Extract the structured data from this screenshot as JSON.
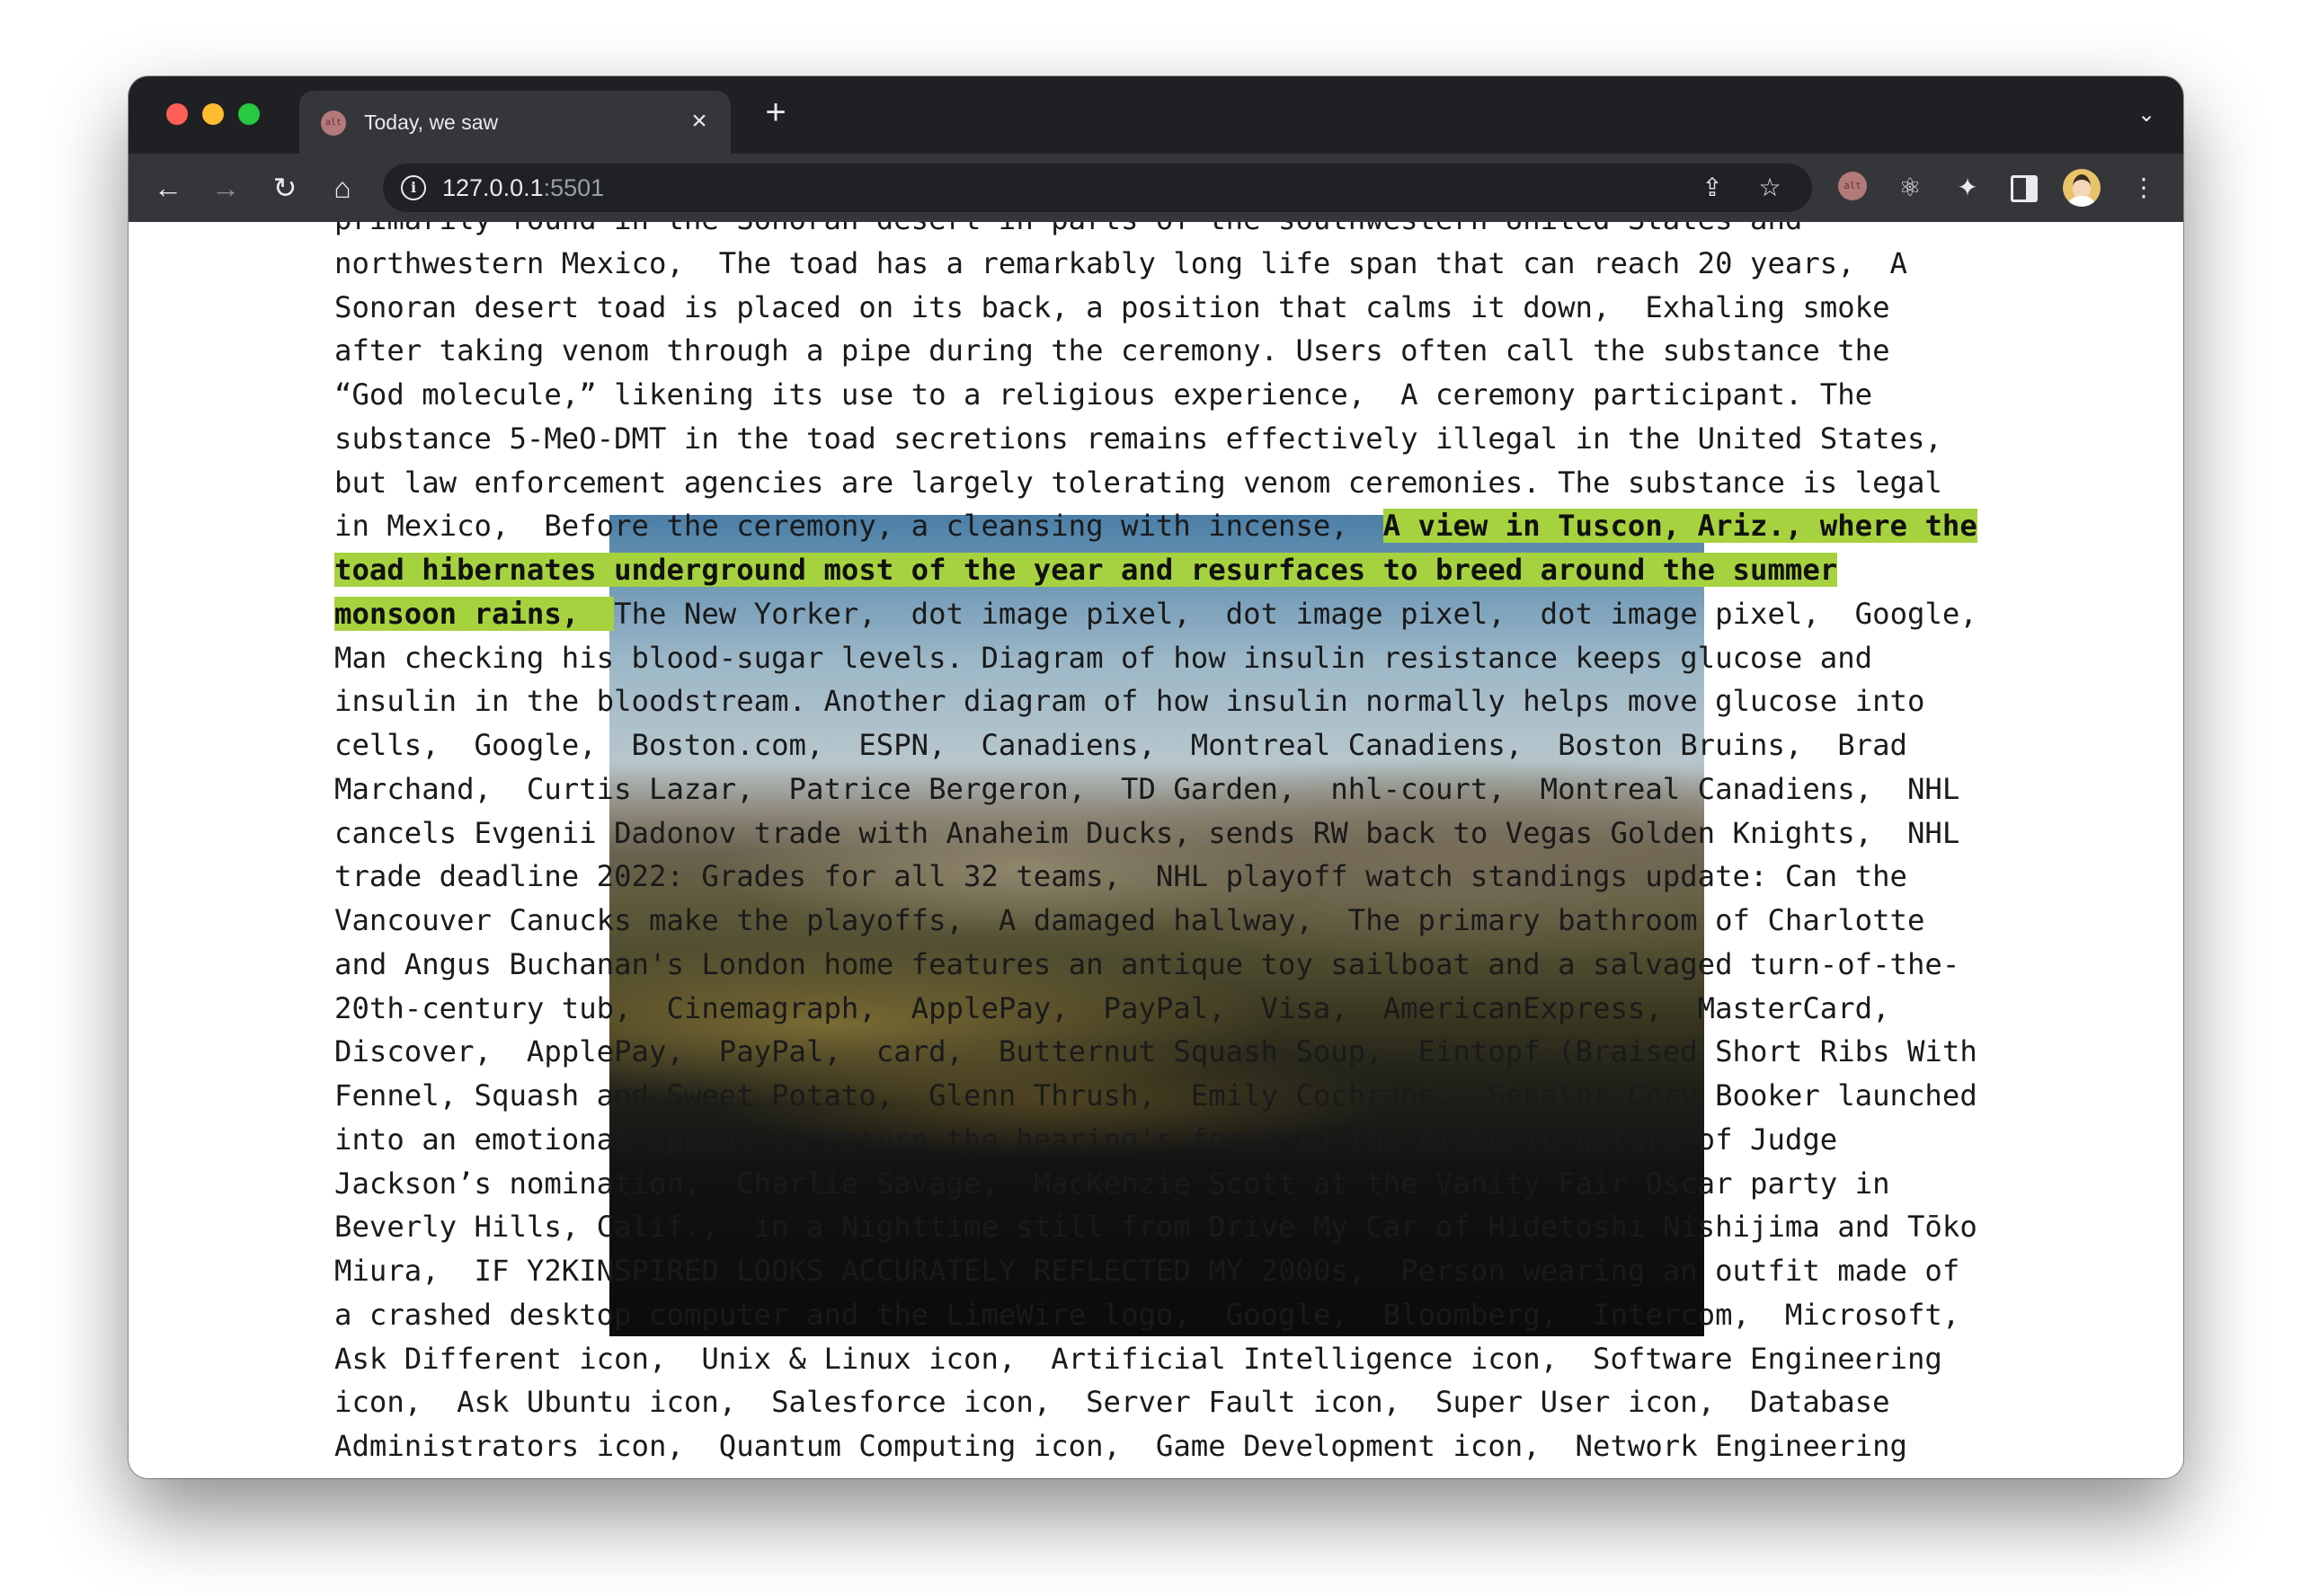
{
  "browser": {
    "tab": {
      "title": "Today, we saw",
      "favicon_text": "alt",
      "close_icon": "×"
    },
    "new_tab_icon": "+",
    "tab_search_icon": "⌄",
    "toolbar": {
      "back_icon": "←",
      "forward_icon": "→",
      "reload_icon": "↻",
      "home_icon": "⌂",
      "url_host": "127.0.0.1",
      "url_port": ":5501",
      "site_info_icon": "i",
      "share_icon": "⇪",
      "bookmark_icon": "☆",
      "extension_alt_text": "alt",
      "react_icon": "⚛",
      "extensions_icon": "✦",
      "menu_icon": "⋮"
    }
  },
  "page": {
    "lines": [
      {
        "before": "primarily found in the Sonoran desert in parts of the southwestern United States and",
        "hl": "",
        "after": ""
      },
      {
        "before": "northwestern Mexico,  The toad has a remarkably long life span that can reach 20 years,  A",
        "hl": "",
        "after": ""
      },
      {
        "before": "Sonoran desert toad is placed on its back, a position that calms it down,  Exhaling smoke",
        "hl": "",
        "after": ""
      },
      {
        "before": "after taking venom through a pipe during the ceremony. Users often call the substance the",
        "hl": "",
        "after": ""
      },
      {
        "before": "“God molecule,” likening its use to a religious experience,  A ceremony participant. The",
        "hl": "",
        "after": ""
      },
      {
        "before": "substance 5-MeO-DMT in the toad secretions remains effectively illegal in the United States,",
        "hl": "",
        "after": ""
      },
      {
        "before": "but law enforcement agencies are largely tolerating venom ceremonies. The substance is legal",
        "hl": "",
        "after": ""
      },
      {
        "before": "in Mexico,  Before the ceremony, a cleansing with incense,  ",
        "hl": "A view in Tuscon, Ariz., where the",
        "after": ""
      },
      {
        "before": "",
        "hl": "toad hibernates underground most of the year and resurfaces to breed around the summer",
        "after": ""
      },
      {
        "before": "",
        "hl": "monsoon rains,  ",
        "after": "The New Yorker,  dot image pixel,  dot image pixel,  dot image pixel,  Google,"
      },
      {
        "before": "Man checking his blood-sugar levels. Diagram of how insulin resistance keeps glucose and",
        "hl": "",
        "after": ""
      },
      {
        "before": "insulin in the bloodstream. Another diagram of how insulin normally helps move glucose into",
        "hl": "",
        "after": ""
      },
      {
        "before": "cells,  Google,  Boston.com,  ESPN,  Canadiens,  Montreal Canadiens,  Boston Bruins,  Brad",
        "hl": "",
        "after": ""
      },
      {
        "before": "Marchand,  Curtis Lazar,  Patrice Bergeron,  TD Garden,  nhl-court,  Montreal Canadiens,  NHL",
        "hl": "",
        "after": ""
      },
      {
        "before": "cancels Evgenii Dadonov trade with Anaheim Ducks, sends RW back to Vegas Golden Knights,  NHL",
        "hl": "",
        "after": ""
      },
      {
        "before": "trade deadline 2022: Grades for all 32 teams,  NHL playoff watch standings update: Can the",
        "hl": "",
        "after": ""
      },
      {
        "before": "Vancouver Canucks make the playoffs,  A damaged hallway,  The primary bathroom of Charlotte",
        "hl": "",
        "after": ""
      },
      {
        "before": "and Angus Buchanan's London home features an antique toy sailboat and a salvaged turn-of-the-",
        "hl": "",
        "after": ""
      },
      {
        "before": "20th-century tub,  Cinemagraph,  ApplePay,  PayPal,  Visa,  AmericanExpress,  MasterCard,",
        "hl": "",
        "after": ""
      },
      {
        "before": "Discover,  ApplePay,  PayPal,  card,  Butternut Squash Soup,  Eintopf (Braised Short Ribs With",
        "hl": "",
        "after": ""
      },
      {
        "before": "Fennel, Squash and Sweet Potato,  Glenn Thrush,  Emily Cochrane,  Senator Cory Booker launched",
        "hl": "",
        "after": ""
      },
      {
        "before": "into an emotional appeal to return the hearing's focus to the historic nature of Judge",
        "hl": "",
        "after": ""
      },
      {
        "before": "Jackson’s nomination,  Charlie Savage,  MacKenzie Scott at the Vanity Fair Oscar party in",
        "hl": "",
        "after": ""
      },
      {
        "before": "Beverly Hills, Calif.,  in a Nighttime still from Drive My Car of Hidetoshi Nishijima and Tōko",
        "hl": "",
        "after": ""
      },
      {
        "before": "Miura,  IF Y2KINSPIRED LOOKS ACCURATELY REFLECTED MY 2000s,  Person wearing an outfit made of",
        "hl": "",
        "after": ""
      },
      {
        "before": "a crashed desktop computer and the LimeWire logo,  Google,  Bloomberg,  Intercom,  Microsoft,",
        "hl": "",
        "after": ""
      },
      {
        "before": "Ask Different icon,  Unix & Linux icon,  Artificial Intelligence icon,  Software Engineering",
        "hl": "",
        "after": ""
      },
      {
        "before": "icon,  Ask Ubuntu icon,  Salesforce icon,  Server Fault icon,  Super User icon,  Database",
        "hl": "",
        "after": ""
      },
      {
        "before": "Administrators icon,  Quantum Computing icon,  Game Development icon,  Network Engineering",
        "hl": "",
        "after": ""
      }
    ],
    "highlight_color": "#a6d23f"
  }
}
